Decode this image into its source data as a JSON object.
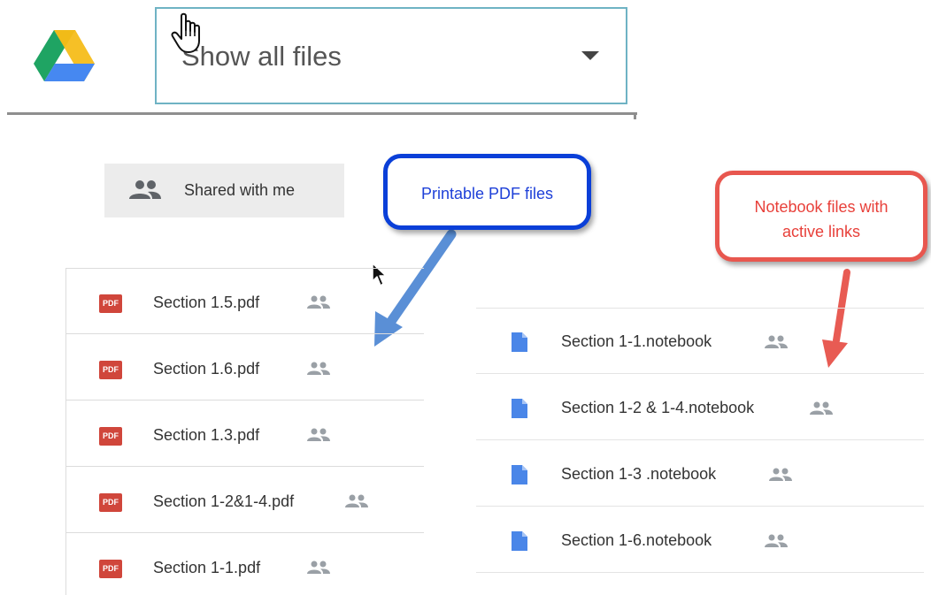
{
  "header": {
    "filter": {
      "selected": "Show all files"
    }
  },
  "sidebar": {
    "shared_with_me": "Shared with me"
  },
  "callouts": {
    "pdf": "Printable PDF files",
    "notebook_line1": "Notebook files with",
    "notebook_line2": "active links"
  },
  "pdf_files": [
    {
      "icon_text": "PDF",
      "name": "Section 1.5.pdf",
      "shared": true
    },
    {
      "icon_text": "PDF",
      "name": "Section 1.6.pdf",
      "shared": true
    },
    {
      "icon_text": "PDF",
      "name": "Section 1.3.pdf",
      "shared": true
    },
    {
      "icon_text": "PDF",
      "name": "Section 1-2&1-4.pdf",
      "shared": true
    },
    {
      "icon_text": "PDF",
      "name": "Section 1-1.pdf",
      "shared": true
    }
  ],
  "notebook_files": [
    {
      "name": "Section 1-1.notebook",
      "shared": true
    },
    {
      "name": "Section 1-2 & 1-4.notebook",
      "shared": true
    },
    {
      "name": "Section 1-3 .notebook",
      "shared": true
    },
    {
      "name": "Section 1-6.notebook",
      "shared": true
    }
  ],
  "colors": {
    "pdf_icon": "#d0463b",
    "doc_icon": "#4a86e8",
    "callout_blue": "#0a3fd8",
    "callout_red": "#e8574f",
    "select_border": "#6fb3c4"
  },
  "icons": {
    "logo": "google-drive-logo",
    "caret": "chevron-down-icon",
    "people": "people-icon",
    "pdf": "pdf-icon",
    "doc": "document-icon"
  }
}
